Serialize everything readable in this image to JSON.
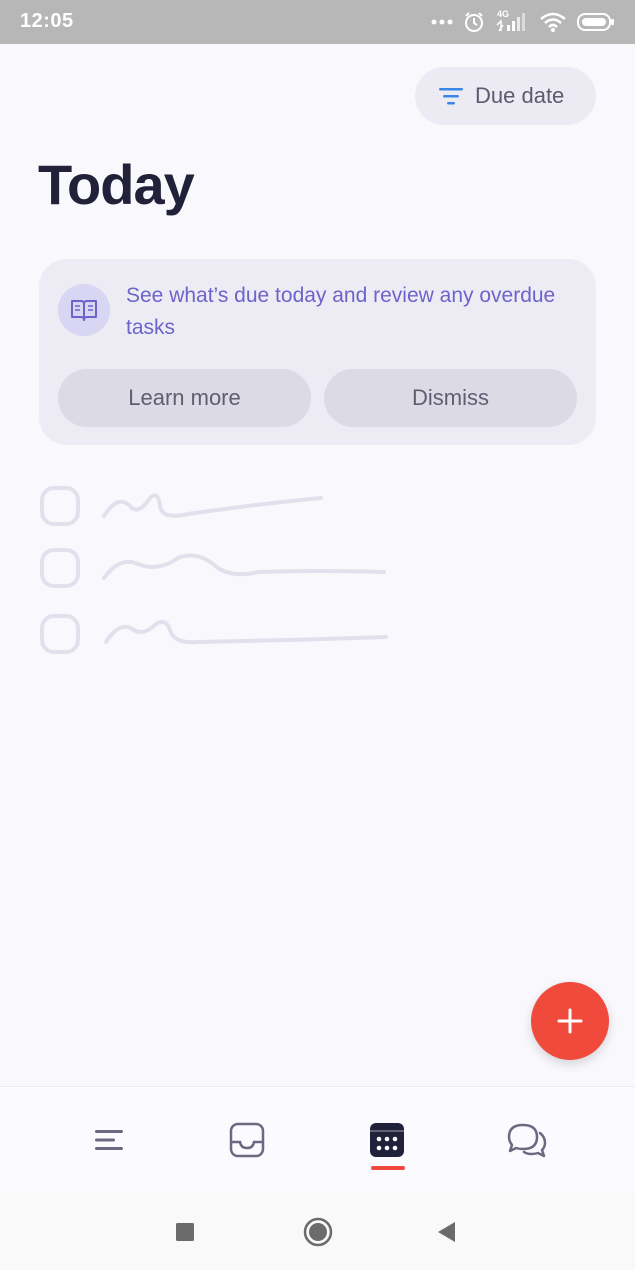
{
  "status_bar": {
    "time": "12:05",
    "network_label": "4G",
    "icons": [
      "more-dots-icon",
      "alarm-icon",
      "signal-icon",
      "wifi-icon",
      "battery-icon"
    ]
  },
  "filter": {
    "label": "Due date",
    "icon": "filter-lines-icon"
  },
  "title": "Today",
  "info_card": {
    "icon": "book-icon",
    "text": "See what’s due today and review any overdue tasks",
    "learn_more": "Learn more",
    "dismiss": "Dismiss"
  },
  "fab": {
    "icon": "plus-icon"
  },
  "bottom_nav": {
    "items": [
      {
        "icon": "menu-icon"
      },
      {
        "icon": "inbox-icon"
      },
      {
        "icon": "calendar-icon",
        "active": true
      },
      {
        "icon": "chat-icon"
      }
    ]
  },
  "system_nav": {
    "icons": [
      "recents-square-icon",
      "home-circle-icon",
      "back-triangle-icon"
    ]
  },
  "colors": {
    "accent": "#ef4a3c",
    "title": "#22213a",
    "info_text": "#6e63c9",
    "filter_icon": "#3a86e8"
  }
}
